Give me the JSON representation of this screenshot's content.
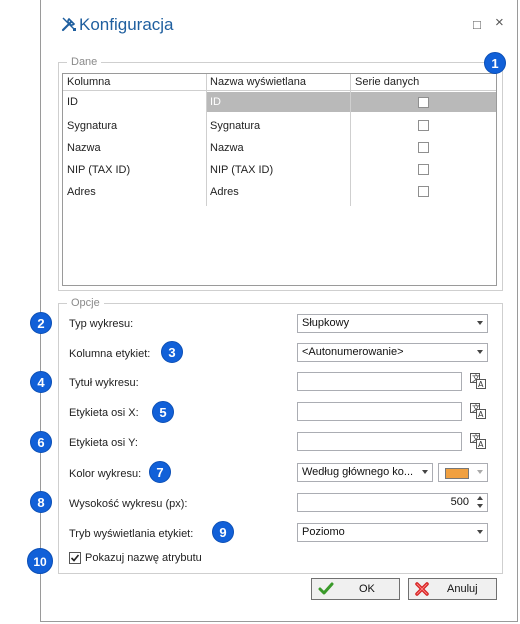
{
  "window": {
    "title": "Konfiguracja",
    "restore_glyph": "□",
    "close_glyph": "×"
  },
  "data_group": {
    "legend": "Dane",
    "columns": [
      "Kolumna",
      "Nazwa wyświetlana",
      "Serie danych"
    ],
    "rows": [
      {
        "kolumna": "ID",
        "nazwa": "ID",
        "serie": false,
        "selected": true
      },
      {
        "kolumna": "Sygnatura",
        "nazwa": "Sygnatura",
        "serie": false,
        "selected": false
      },
      {
        "kolumna": "Nazwa",
        "nazwa": "Nazwa",
        "serie": false,
        "selected": false
      },
      {
        "kolumna": "NIP (TAX ID)",
        "nazwa": "NIP (TAX ID)",
        "serie": false,
        "selected": false
      },
      {
        "kolumna": "Adres",
        "nazwa": "Adres",
        "serie": false,
        "selected": false
      }
    ]
  },
  "options_group": {
    "legend": "Opcje",
    "typ_wykresu": {
      "label": "Typ wykresu:",
      "value": "Słupkowy"
    },
    "kolumna_etykiet": {
      "label": "Kolumna etykiet:",
      "value": "<Autonumerowanie>"
    },
    "tytul_wykresu": {
      "label": "Tytuł wykresu:",
      "value": ""
    },
    "etykieta_x": {
      "label": "Etykieta osi X:",
      "value": ""
    },
    "etykieta_y": {
      "label": "Etykieta osi Y:",
      "value": ""
    },
    "kolor_wykresu": {
      "label": "Kolor wykresu:",
      "value": "Według głównego ko...",
      "swatch": "#f0a040"
    },
    "wysokosc": {
      "label": "Wysokość wykresu (px):",
      "value": "500"
    },
    "tryb_etykiet": {
      "label": "Tryb wyświetlania etykiet:",
      "value": "Poziomo"
    },
    "pokazuj_nazwe": {
      "label": "Pokazuj nazwę atrybutu",
      "checked": true
    }
  },
  "badges": [
    "1",
    "2",
    "3",
    "4",
    "5",
    "6",
    "7",
    "8",
    "9",
    "10"
  ],
  "buttons": {
    "ok": "OK",
    "cancel": "Anuluj"
  },
  "colors": {
    "accent": "#1160d8",
    "title": "#1f5f9f",
    "selection": "#b9b9b9"
  }
}
